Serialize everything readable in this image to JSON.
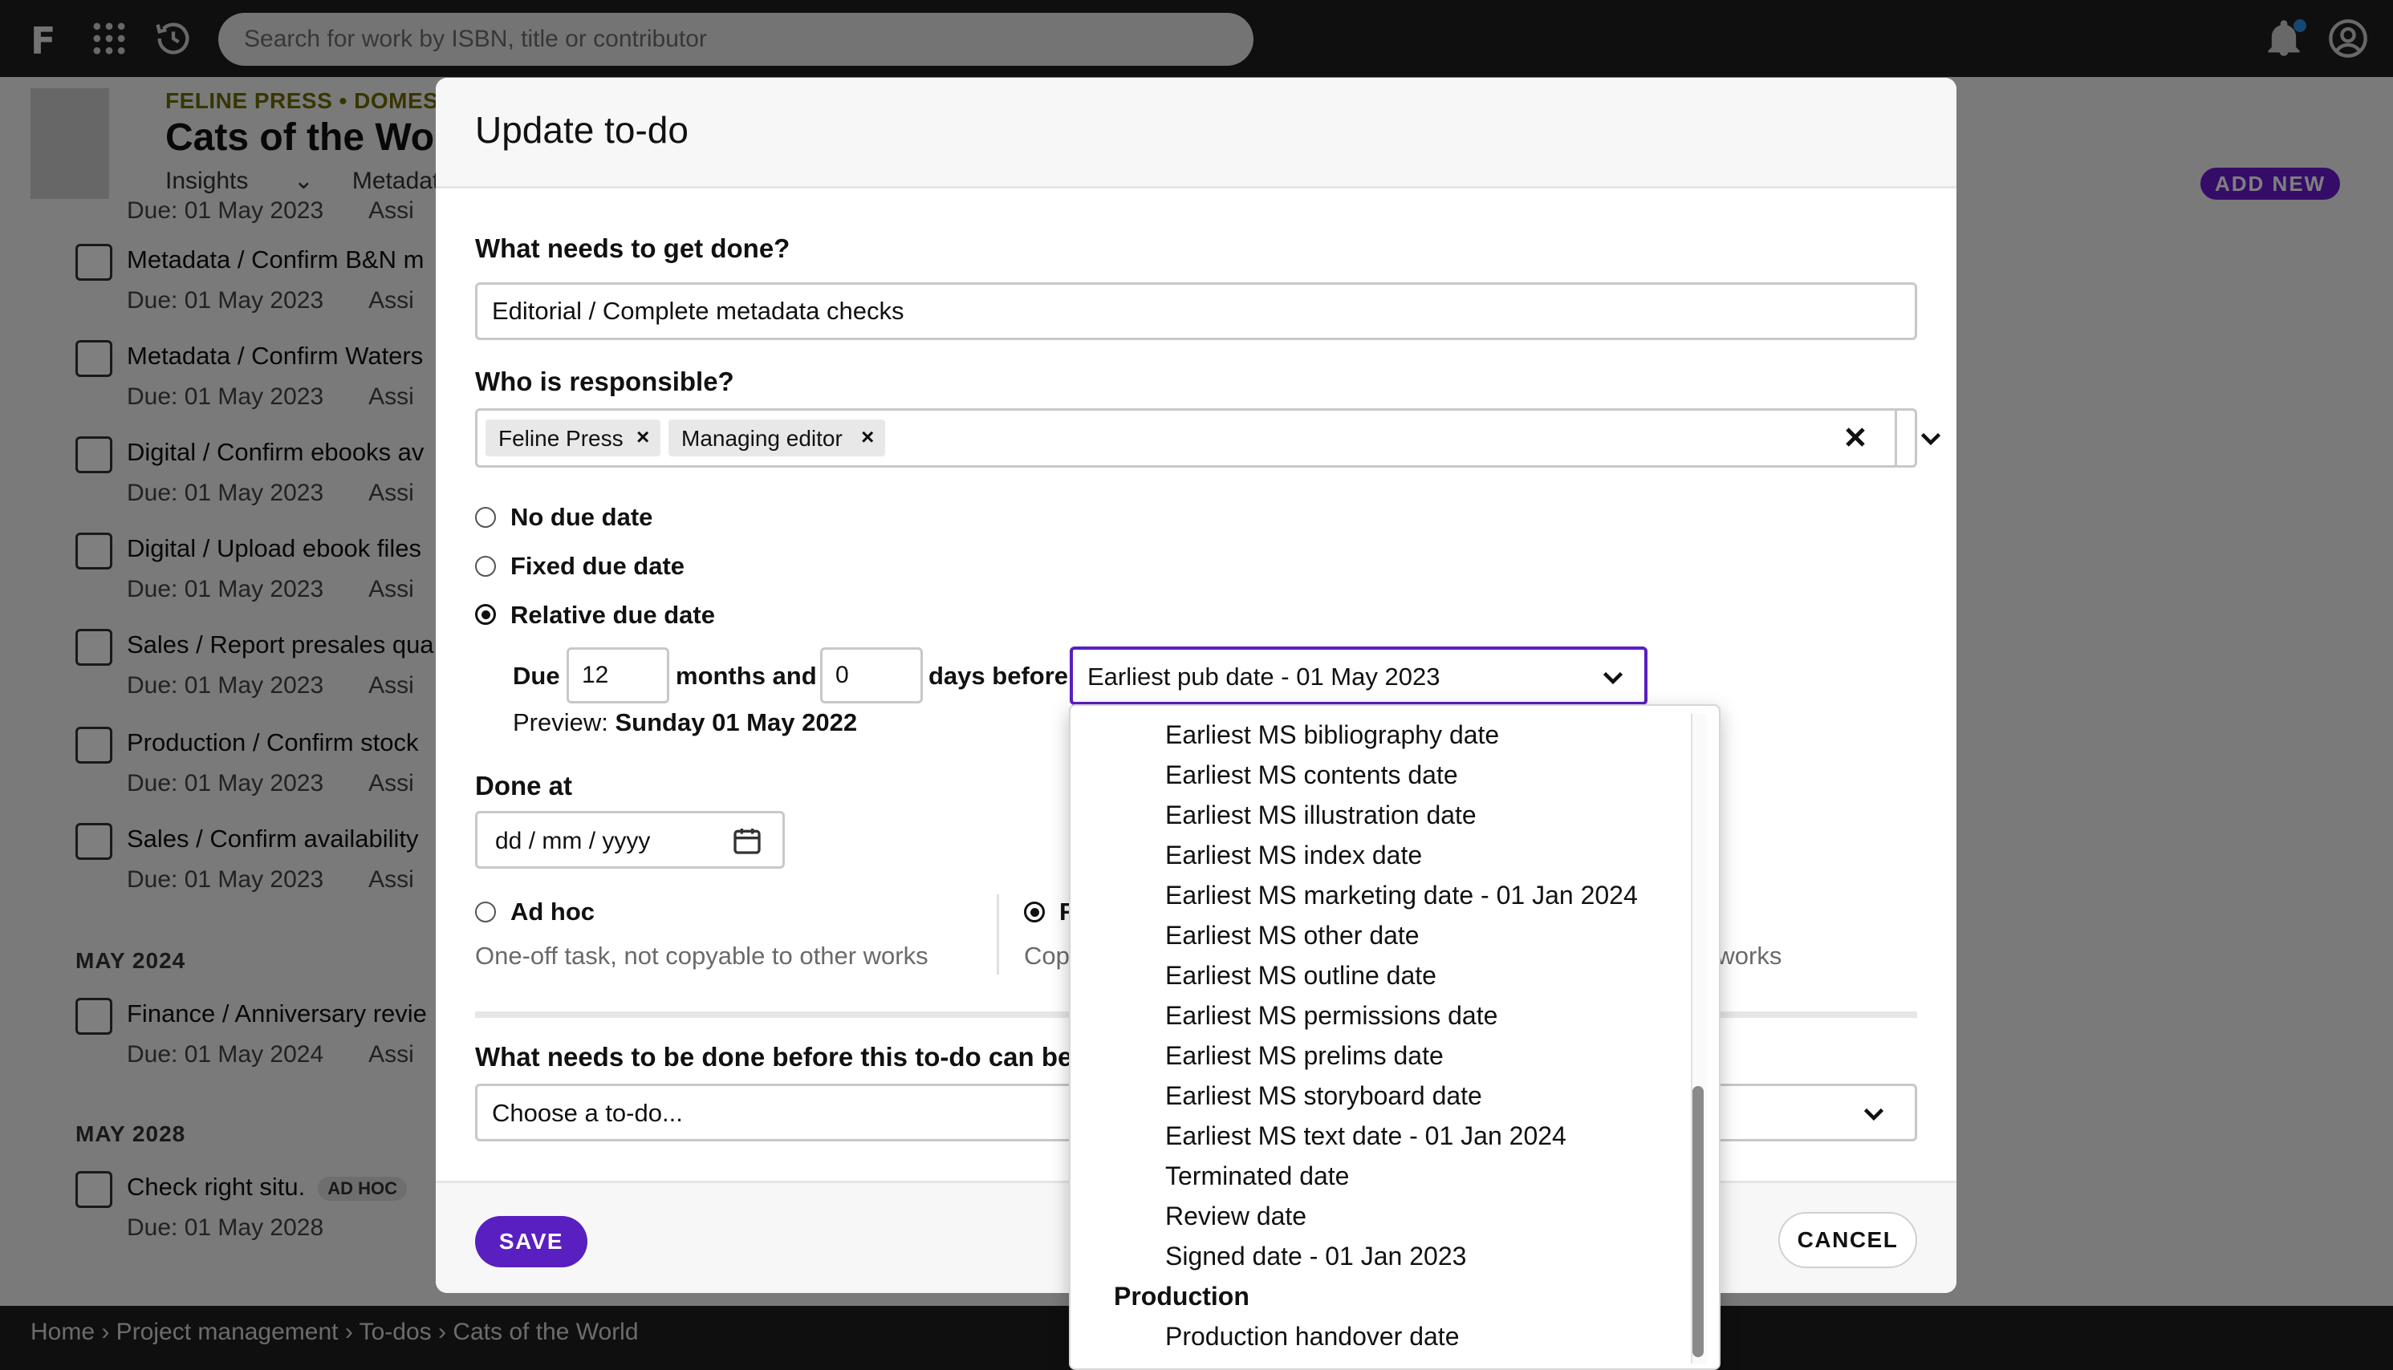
{
  "topbar": {
    "logo": "F",
    "search_placeholder": "Search for work by ISBN, title or contributor",
    "icons": [
      "apps-grid-icon",
      "history-icon",
      "bell-icon",
      "account-icon"
    ]
  },
  "page": {
    "imprint": "FELINE PRESS • DOMEST",
    "title": "Cats of the Wo",
    "tabs": [
      "Insights",
      "Metadata"
    ],
    "add_new": "ADD NEW",
    "todos": [
      {
        "text": "",
        "due": "Due: 01 May 2023",
        "assignee": "Assi"
      },
      {
        "text": "Metadata / Confirm B&N m",
        "due": "Due: 01 May 2023",
        "assignee": "Assi"
      },
      {
        "text": "Metadata / Confirm Waters",
        "due": "Due: 01 May 2023",
        "assignee": "Assi"
      },
      {
        "text": "Digital / Confirm ebooks av",
        "due": "Due: 01 May 2023",
        "assignee": "Assi"
      },
      {
        "text": "Digital / Upload ebook files",
        "due": "Due: 01 May 2023",
        "assignee": "Assi"
      },
      {
        "text": "Sales / Report presales qua",
        "due": "Due: 01 May 2023",
        "assignee": "Assi"
      },
      {
        "text": "Production / Confirm stock",
        "due": "Due: 01 May 2023",
        "assignee": "Assi"
      },
      {
        "text": "Sales / Confirm availability",
        "due": "Due: 01 May 2023",
        "assignee": "Assi"
      }
    ],
    "month_2024": "MAY 2024",
    "todo_2024": {
      "text": "Finance / Anniversary revie",
      "due": "Due: 01 May 2024",
      "assignee": "Assi"
    },
    "month_2028": "MAY 2028",
    "todo_2028": {
      "text": "Check right situ.",
      "badge": "AD HOC",
      "due": "Due: 01 May 2028"
    }
  },
  "footer": {
    "breadcrumb": "Home › Project management › To-dos › Cats of the World"
  },
  "modal": {
    "title": "Update to-do",
    "what_label": "What needs to get done?",
    "what_value": "Editorial / Complete metadata checks",
    "who_label": "Who is responsible?",
    "chips": [
      "Feline Press",
      "Managing editor"
    ],
    "chip_remove": "×",
    "due_options": {
      "none": "No due date",
      "fixed": "Fixed due date",
      "relative": "Relative due date",
      "selected": "relative"
    },
    "due_prefix": "Due",
    "months_value": "12",
    "months_and": "months and",
    "days_value": "0",
    "days_before": "days before",
    "relative_to": "Earliest pub date - 01 May 2023",
    "preview_label": "Preview:",
    "preview_value": "Sunday 01 May 2022",
    "done_at_label": "Done at",
    "done_at_placeholder": "dd / mm / yyyy",
    "type_options": {
      "adhoc": "Ad hoc",
      "adhoc_desc": "One-off task, not copyable to other works",
      "recurring_partial": "R",
      "recurring_desc_partial": "Cop",
      "recurring_desc_tail": "ner works",
      "selected": "recurring"
    },
    "dependency_label": "What needs to be done before this to-do can be wo",
    "dependency_placeholder": "Choose a to-do...",
    "save": "SAVE",
    "cancel": "CANCEL"
  },
  "dropdown": {
    "items": [
      "Earliest MS bibliography date",
      "Earliest MS contents date",
      "Earliest MS illustration date",
      "Earliest MS index date",
      "Earliest MS marketing date - 01 Jan 2024",
      "Earliest MS other date",
      "Earliest MS outline date",
      "Earliest MS permissions date",
      "Earliest MS prelims date",
      "Earliest MS storyboard date",
      "Earliest MS text date - 01 Jan 2024",
      "Terminated date",
      "Review date",
      "Signed date - 01 Jan 2023"
    ],
    "group_production": "Production",
    "production_items": [
      "Production handover date"
    ]
  }
}
